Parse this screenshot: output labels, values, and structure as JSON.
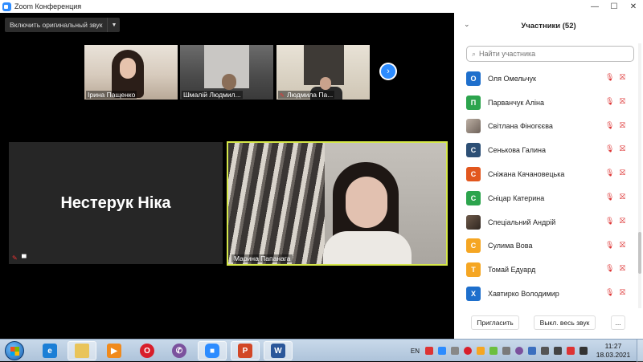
{
  "window": {
    "title": "Zoom Конференция",
    "controls": [
      "—",
      "☐",
      "✕"
    ]
  },
  "meeting": {
    "original_sound_label": "Включить оригинальный звук",
    "thumbnails": [
      {
        "name": "Ірина Пащенко",
        "muted": false
      },
      {
        "name": "Шмалій Людмил...",
        "muted": false
      },
      {
        "name": "Людмила Па...",
        "muted": true
      }
    ],
    "next_page_icon": "›",
    "name_tile": "Нестерук Ніка",
    "active_speaker": "Марина Папанага"
  },
  "participants_panel": {
    "title": "Участники (52)",
    "search_placeholder": "Найти участника",
    "participants": [
      {
        "initial": "О",
        "name": "Оля Омельчук",
        "color": "#1e6fcc",
        "photo": false
      },
      {
        "initial": "П",
        "name": "Парванчук Аліна",
        "color": "#2ca44d",
        "photo": false
      },
      {
        "initial": "",
        "name": "Світлана Фіногєєва",
        "color": "#9a8c80",
        "photo": true
      },
      {
        "initial": "С",
        "name": "Сенькова Галина",
        "color": "#2d4f75",
        "photo": false
      },
      {
        "initial": "С",
        "name": "Сніжана Качановецька",
        "color": "#e2571e",
        "photo": false
      },
      {
        "initial": "С",
        "name": "Сніцар Катерина",
        "color": "#2ca44d",
        "photo": false
      },
      {
        "initial": "",
        "name": "Спеціальний Андрій",
        "color": "#5a4a3e",
        "photo": true
      },
      {
        "initial": "С",
        "name": "Сулима Вова",
        "color": "#f5a623",
        "photo": false
      },
      {
        "initial": "Т",
        "name": "Томай Едуард",
        "color": "#f5a623",
        "photo": false
      },
      {
        "initial": "Х",
        "name": "Хавтирко Володимир",
        "color": "#1e6fcc",
        "photo": false
      }
    ],
    "buttons": {
      "invite": "Пригласить",
      "mute_all": "Выкл. весь звук",
      "more": "..."
    }
  },
  "taskbar": {
    "language": "EN",
    "time": "11:27",
    "date": "18.03.2021",
    "apps": [
      {
        "name": "internet-explorer",
        "glyph": "e",
        "color": "#1c7fd6"
      },
      {
        "name": "file-explorer",
        "glyph": "",
        "color": "#e9c45a"
      },
      {
        "name": "media-player",
        "glyph": "▶",
        "color": "#f08a1c"
      },
      {
        "name": "opera",
        "glyph": "O",
        "color": "#d81e2a"
      },
      {
        "name": "viber",
        "glyph": "✆",
        "color": "#7b519d"
      },
      {
        "name": "zoom",
        "glyph": "■",
        "color": "#2d8cff"
      },
      {
        "name": "powerpoint",
        "glyph": "P",
        "color": "#d24726"
      },
      {
        "name": "word",
        "glyph": "W",
        "color": "#2b579a"
      }
    ]
  }
}
